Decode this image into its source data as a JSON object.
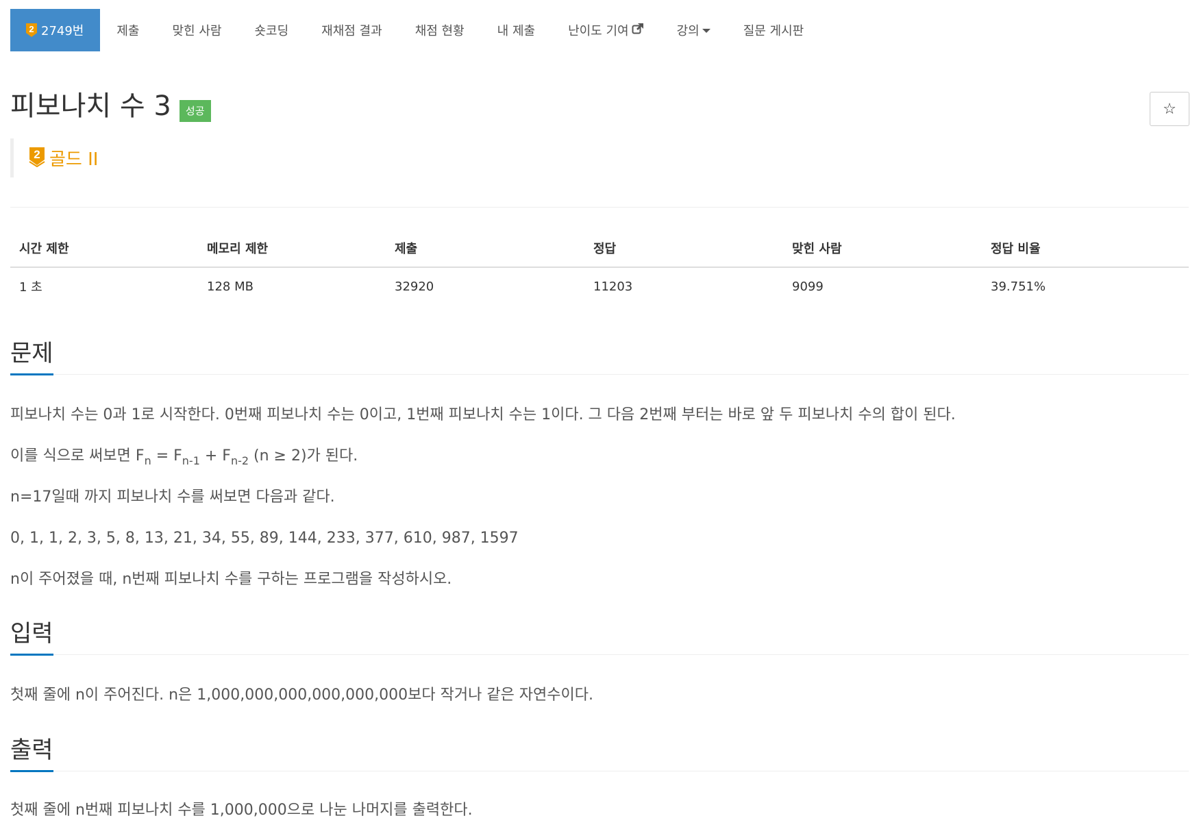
{
  "nav": {
    "items": [
      {
        "label": "2749번",
        "active": true,
        "tier_digit": "2"
      },
      {
        "label": "제출"
      },
      {
        "label": "맞힌 사람"
      },
      {
        "label": "숏코딩"
      },
      {
        "label": "재채점 결과"
      },
      {
        "label": "채점 현황"
      },
      {
        "label": "내 제출"
      },
      {
        "label": "난이도 기여",
        "icon": "external-link-icon"
      },
      {
        "label": "강의",
        "icon": "caret-down-icon"
      },
      {
        "label": "질문 게시판"
      }
    ]
  },
  "problem": {
    "title": "피보나치 수 3",
    "status_label": "성공",
    "star_icon": "☆",
    "tier_digit": "2",
    "tier_label": "골드 II",
    "tier_color": "#ec9a00"
  },
  "info_table": {
    "headers": [
      "시간 제한",
      "메모리 제한",
      "제출",
      "정답",
      "맞힌 사람",
      "정답 비율"
    ],
    "values": [
      "1 초",
      "128 MB",
      "32920",
      "11203",
      "9099",
      "39.751%"
    ]
  },
  "sections": {
    "problem": {
      "heading": "문제",
      "p1": "피보나치 수는 0과 1로 시작한다. 0번째 피보나치 수는 0이고, 1번째 피보나치 수는 1이다. 그 다음 2번째 부터는 바로 앞 두 피보나치 수의 합이 된다.",
      "p2_prefix": "이를 식으로 써보면 F",
      "p2_sub1": "n",
      "p2_mid1": " = F",
      "p2_sub2": "n-1",
      "p2_mid2": " + F",
      "p2_sub3": "n-2",
      "p2_suffix": " (n ≥ 2)가 된다.",
      "p3": "n=17일때 까지 피보나치 수를 써보면 다음과 같다.",
      "p4": "0, 1, 1, 2, 3, 5, 8, 13, 21, 34, 55, 89, 144, 233, 377, 610, 987, 1597",
      "p5": "n이 주어졌을 때, n번째 피보나치 수를 구하는 프로그램을 작성하시오."
    },
    "input": {
      "heading": "입력",
      "p1": "첫째 줄에 n이 주어진다. n은 1,000,000,000,000,000,000보다 작거나 같은 자연수이다."
    },
    "output": {
      "heading": "출력",
      "p1": "첫째 줄에 n번째 피보나치 수를 1,000,000으로 나눈 나머지를 출력한다."
    }
  }
}
